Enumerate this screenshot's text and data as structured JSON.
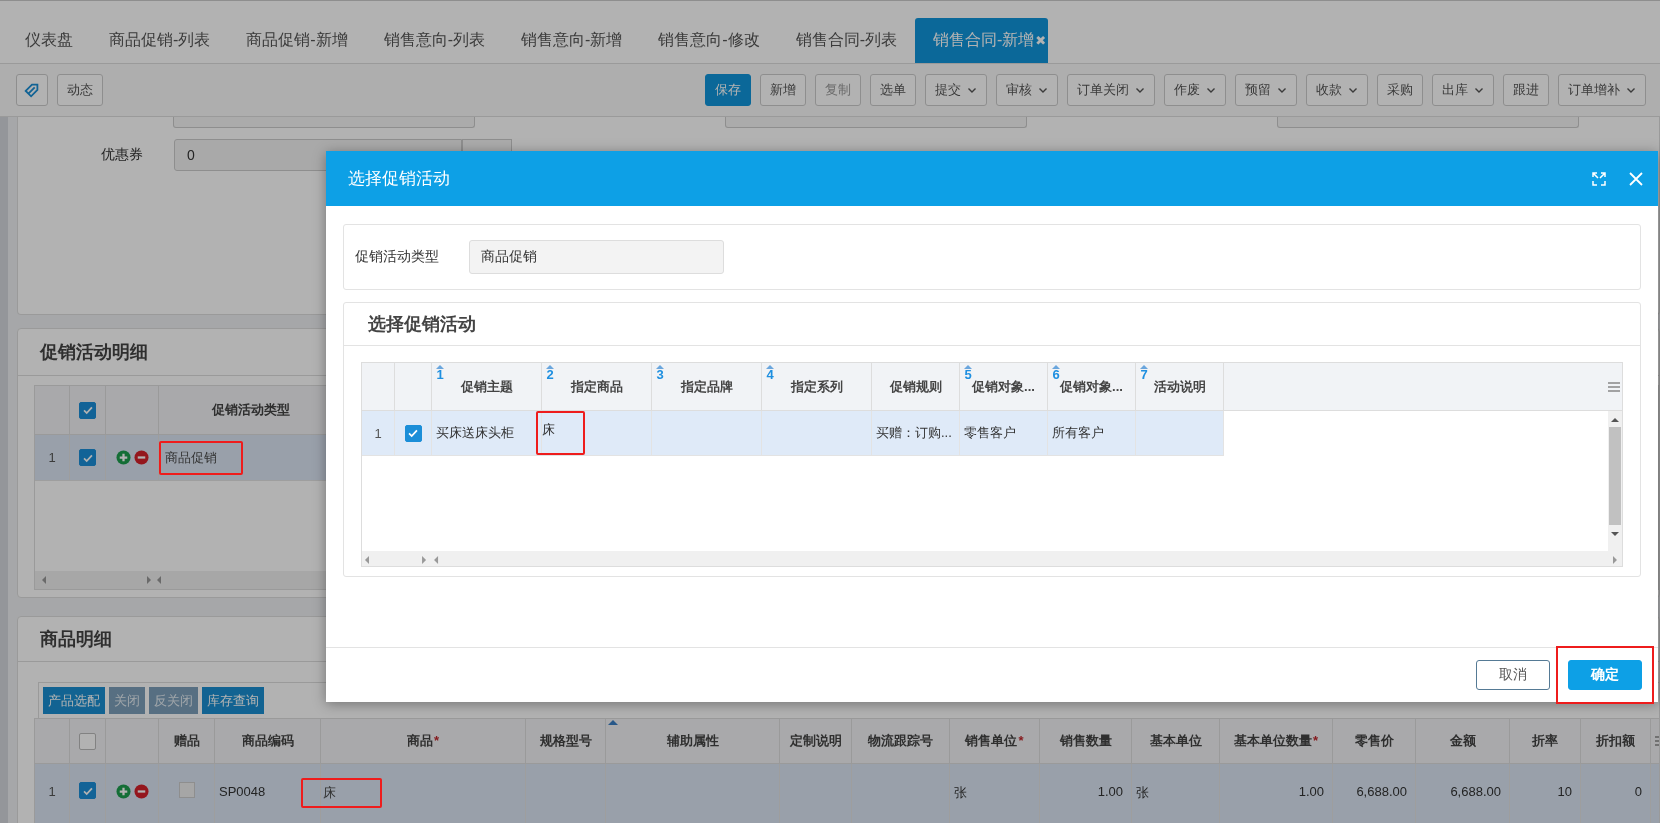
{
  "tabs": [
    {
      "label": "仪表盘",
      "selected": false
    },
    {
      "label": "商品促销-列表",
      "selected": false
    },
    {
      "label": "商品促销-新增",
      "selected": false
    },
    {
      "label": "销售意向-列表",
      "selected": false
    },
    {
      "label": "销售意向-新增",
      "selected": false
    },
    {
      "label": "销售意向-修改",
      "selected": false
    },
    {
      "label": "销售合同-列表",
      "selected": false
    },
    {
      "label": "销售合同-新增",
      "selected": true,
      "close_label": "✖"
    }
  ],
  "toolbar": {
    "left_buttons": [
      {
        "label": "动态"
      }
    ],
    "right_buttons": [
      {
        "label": "保存",
        "kind": "primary",
        "disabled": false,
        "menu": false
      },
      {
        "label": "新增",
        "kind": "default",
        "disabled": false,
        "menu": false
      },
      {
        "label": "复制",
        "kind": "default",
        "disabled": true,
        "menu": false
      },
      {
        "label": "选单",
        "kind": "default",
        "disabled": false,
        "menu": false
      },
      {
        "label": "提交",
        "kind": "default",
        "disabled": false,
        "menu": true
      },
      {
        "label": "审核",
        "kind": "default",
        "disabled": false,
        "menu": true
      },
      {
        "label": "订单关闭",
        "kind": "default",
        "disabled": false,
        "menu": true
      },
      {
        "label": "作废",
        "kind": "default",
        "disabled": false,
        "menu": true
      },
      {
        "label": "预留",
        "kind": "default",
        "disabled": false,
        "menu": true
      },
      {
        "label": "收款",
        "kind": "default",
        "disabled": false,
        "menu": true
      },
      {
        "label": "采购",
        "kind": "default",
        "disabled": false,
        "menu": false
      },
      {
        "label": "出库",
        "kind": "default",
        "disabled": false,
        "menu": true
      },
      {
        "label": "跟进",
        "kind": "default",
        "disabled": false,
        "menu": false
      },
      {
        "label": "订单增补",
        "kind": "default",
        "disabled": false,
        "menu": true
      }
    ]
  },
  "form": {
    "fields": [
      {
        "label": "优惠券",
        "value": "0"
      }
    ]
  },
  "promo_detail": {
    "title": "促销活动明细",
    "all_checked": true,
    "columns": [
      {
        "label": "促销活动类型"
      }
    ],
    "rows": [
      {
        "index": "1",
        "checked": true,
        "selected": true,
        "cells": [
          {
            "text": "商品促销",
            "highlighted": true
          }
        ]
      }
    ]
  },
  "goods_detail": {
    "title": "商品明细",
    "buttons": [
      {
        "label": "产品选配",
        "disabled": false
      },
      {
        "label": "关闭",
        "disabled": true
      },
      {
        "label": "反关闭",
        "disabled": true
      },
      {
        "label": "库存查询",
        "disabled": false
      }
    ],
    "all_checked": false,
    "columns": [
      {
        "label": "赠品",
        "kind": "check"
      },
      {
        "label": "商品编码",
        "kind": "text"
      },
      {
        "label": "商品",
        "kind": "text",
        "required_mark": "*"
      },
      {
        "label": "规格型号",
        "kind": "text"
      },
      {
        "label": "辅助属性",
        "kind": "text",
        "sorted": true
      },
      {
        "label": "定制说明",
        "kind": "text"
      },
      {
        "label": "物流跟踪号",
        "kind": "text"
      },
      {
        "label": "销售单位",
        "kind": "text",
        "required_mark": "*"
      },
      {
        "label": "销售数量",
        "kind": "number"
      },
      {
        "label": "基本单位",
        "kind": "text"
      },
      {
        "label": "基本单位数量",
        "kind": "number",
        "required_mark": "*"
      },
      {
        "label": "零售价",
        "kind": "number"
      },
      {
        "label": "金额",
        "kind": "number"
      },
      {
        "label": "折率",
        "kind": "number"
      },
      {
        "label": "折扣额",
        "kind": "number"
      }
    ],
    "rows": [
      {
        "index": "1",
        "checked": true,
        "selected": true,
        "cells": [
          {
            "checked": false
          },
          {
            "text": "SP0048"
          },
          {
            "text": "床",
            "highlighted": true
          },
          {},
          {},
          {},
          {},
          {
            "text": "张"
          },
          {
            "text": "1.00"
          },
          {
            "text": "张"
          },
          {
            "text": "1.00"
          },
          {
            "text": "6,688.00"
          },
          {
            "text": "6,688.00"
          },
          {
            "text": "10"
          },
          {
            "text": "0"
          }
        ]
      }
    ]
  },
  "dialog": {
    "title": "选择促销活动",
    "filter": {
      "label": "促销活动类型",
      "value": "商品促销"
    },
    "section_title": "选择促销活动",
    "columns": [
      {
        "label": "促销主题",
        "sort_index": "1"
      },
      {
        "label": "指定商品",
        "sort_index": "2"
      },
      {
        "label": "指定品牌",
        "sort_index": "3"
      },
      {
        "label": "指定系列",
        "sort_index": "4"
      },
      {
        "label": "促销规则"
      },
      {
        "label": "促销对象...",
        "sort_index": "5"
      },
      {
        "label": "促销对象...",
        "sort_index": "6"
      },
      {
        "label": "活动说明",
        "sort_index": "7"
      }
    ],
    "rows": [
      {
        "index": "1",
        "checked": true,
        "selected": true,
        "cells": [
          {
            "text": "买床送床头柜"
          },
          {
            "text": "床",
            "highlighted": true
          },
          {},
          {},
          {
            "text": "买赠：订购..."
          },
          {
            "text": "零售客户"
          },
          {
            "text": "所有客户"
          },
          {}
        ]
      }
    ],
    "buttons": [
      {
        "label": "取消",
        "kind": "secondary",
        "highlighted": false
      },
      {
        "label": "确定",
        "kind": "primary",
        "highlighted": true
      }
    ]
  }
}
